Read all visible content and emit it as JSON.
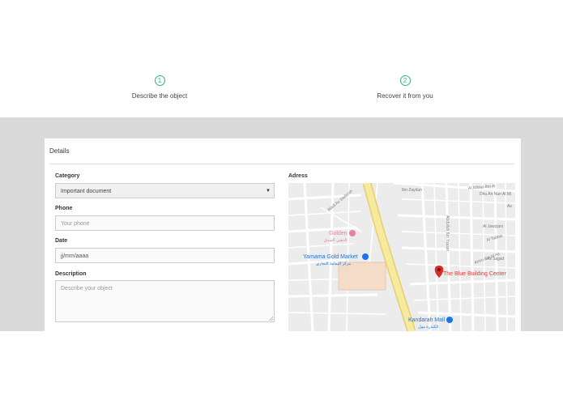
{
  "steps": [
    {
      "number": "1",
      "label": "Describe the object"
    },
    {
      "number": "2",
      "label": "Recover it from you"
    }
  ],
  "details": {
    "title": "Details",
    "category": {
      "label": "Category",
      "value": "Important document"
    },
    "phone": {
      "label": "Phone",
      "placeholder": "Your phone"
    },
    "date": {
      "label": "Date",
      "value": "jj/mm/aaaa"
    },
    "description": {
      "label": "Description",
      "placeholder": "Describe your object"
    }
  },
  "map": {
    "label": "Adress",
    "places": {
      "golden": "Golden",
      "golden_ar": "الذهبي الفندق",
      "yamama": "Yamama Gold Market",
      "yamama_ar": "مركز اليمامة التجاري",
      "blue_building": "The Blue Building Center",
      "kandarah": "Kandarah Mall",
      "kandarah_ar": "الكندرة مول"
    },
    "streets": {
      "ibn_zaydun": "Ibn Zaydun",
      "al_abbas": "Al Abbas Ibn Al",
      "dhu_an_nun": "Dhu An Nun Al Mi",
      "wadi_as_sadarah": "Wadi As Sadarah",
      "abdullah": "Abdullah Ibn Yasser",
      "al_jawzjani": "Al Jawzjani",
      "al_tabbib": "Al Tabbib",
      "amru_bin_al": "Amru Bin Al As",
      "as_sajjad": "As Sajjad",
      "as_aj": "As"
    },
    "colors": {
      "road": "#f6e9a0",
      "road_edge": "#e8cf6c",
      "pin": "#d32f2f",
      "poi_label": "#e53935",
      "poi_blue": "#1a73e8",
      "poi_pink": "#e57fa6"
    }
  }
}
